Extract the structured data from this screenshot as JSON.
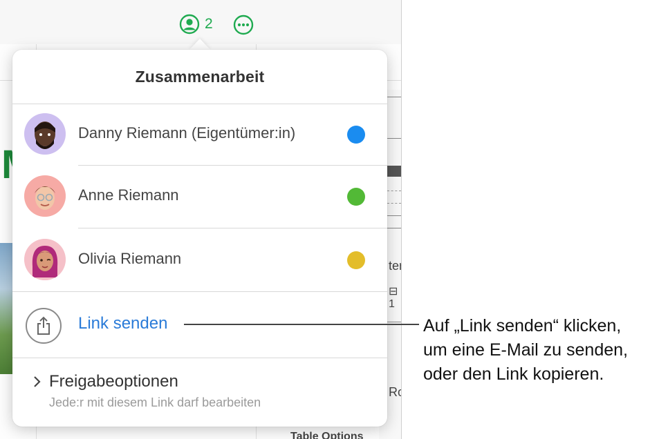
{
  "toolbar": {
    "collaborator_count": "2",
    "collaborate_icon": "person-circle-icon",
    "more_icon": "ellipsis-circle-icon",
    "accent_color": "#1faa50"
  },
  "background": {
    "table_options_label": "Table Options",
    "side_text_1": "ter",
    "side_text_2": "⊟ 1",
    "side_text_3": "Ro"
  },
  "popover": {
    "title": "Zusammenarbeit",
    "participants": [
      {
        "name": "Danny Riemann (Eigentümer:in)",
        "color": "#1a8cf0"
      },
      {
        "name": "Anne Riemann",
        "color": "#52b936"
      },
      {
        "name": "Olivia Riemann",
        "color": "#e3bd2a"
      }
    ],
    "share_link_label": "Link senden",
    "share_icon": "share-icon",
    "options_title": "Freigabeoptionen",
    "options_subtitle": "Jede:r mit diesem Link darf bearbeiten",
    "link_color": "#2a7bd8"
  },
  "callout": {
    "lines": [
      "Auf „Link senden“ klicken,",
      "um eine E-Mail zu senden,",
      "oder den Link kopieren."
    ]
  }
}
